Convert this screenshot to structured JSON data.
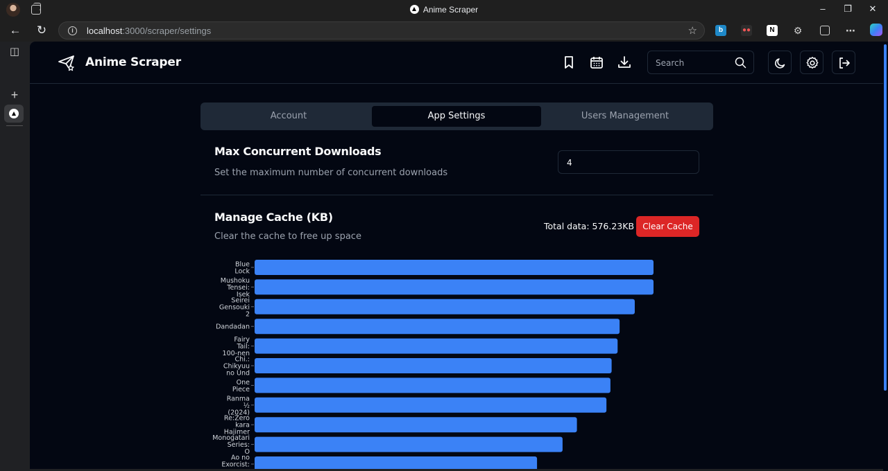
{
  "browser": {
    "window_title": "Anime Scraper",
    "url_host": "localhost",
    "url_path": ":3000/scraper/settings"
  },
  "app": {
    "brand": "Anime Scraper",
    "search_placeholder": "Search"
  },
  "tabs": [
    {
      "label": "Account",
      "active": false
    },
    {
      "label": "App Settings",
      "active": true
    },
    {
      "label": "Users Management",
      "active": false
    }
  ],
  "downloads": {
    "title": "Max Concurrent Downloads",
    "description": "Set the maximum number of concurrent downloads",
    "value": "4"
  },
  "cache": {
    "title": "Manage Cache (KB)",
    "description": "Clear the cache to free up space",
    "total_label": "Total data: 576.23KB",
    "clear_label": "Clear Cache"
  },
  "colors": {
    "bar": "#3b82f6",
    "danger": "#dc2626",
    "background": "#030712",
    "border": "#1f2937"
  },
  "chart_data": {
    "type": "bar",
    "orientation": "horizontal",
    "categories": [
      [
        "Blue",
        "Lock"
      ],
      [
        "Mushoku",
        "Tensei:",
        "Isek"
      ],
      [
        "Seirei",
        "Gensouki",
        "2"
      ],
      [
        "Dandadan"
      ],
      [
        "Fairy",
        "Tail:",
        "100-nen"
      ],
      [
        "Chi.:",
        "Chikyuu",
        "no Und"
      ],
      [
        "One",
        "Piece"
      ],
      [
        "Ranma",
        "½",
        "(2024)"
      ],
      [
        "Re:Zero",
        "kara",
        "Hajimer"
      ],
      [
        "Monogatari",
        "Series:",
        "O"
      ],
      [
        "Ao no",
        "Exorcist:",
        "..."
      ]
    ],
    "values": [
      100,
      100,
      95.3,
      91.5,
      91.0,
      89.5,
      89.2,
      88.2,
      80.8,
      77.2,
      70.8
    ],
    "xlim": [
      0,
      100
    ],
    "xlabel": "",
    "ylabel": ""
  }
}
